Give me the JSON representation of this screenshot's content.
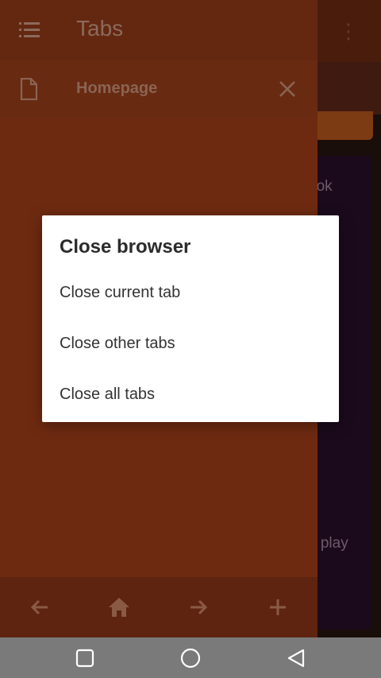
{
  "drawer": {
    "title": "Tabs",
    "tabs": [
      {
        "label": "Homepage"
      }
    ]
  },
  "dialog": {
    "title": "Close browser",
    "items": [
      {
        "label": "Close current tab"
      },
      {
        "label": "Close other tabs"
      },
      {
        "label": "Close all tabs"
      }
    ]
  },
  "background": {
    "fragments": [
      "ook",
      "e play"
    ]
  },
  "icons": {
    "drawer_menu": "list-icon",
    "tab_page": "page-icon",
    "tab_close": "close-icon",
    "back": "arrow-left-icon",
    "home": "home-icon",
    "forward": "arrow-right-icon",
    "new_tab": "plus-icon",
    "sys_recents": "square-icon",
    "sys_home": "circle-icon",
    "sys_back": "triangle-back-icon"
  },
  "colors": {
    "drawer": "#6e2a11",
    "dialog": "#ffffff",
    "system_bar": "#7a7a7a"
  }
}
